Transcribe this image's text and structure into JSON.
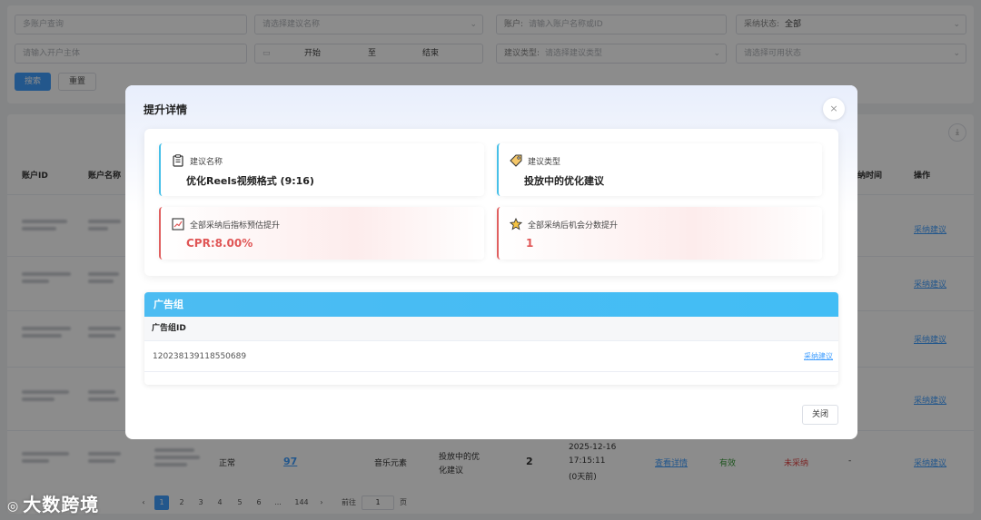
{
  "filters": {
    "row1": [
      {
        "placeholder": "多账户查询"
      },
      {
        "placeholder": "请选择建议名称"
      },
      {
        "label": "账户:",
        "placeholder": "请输入账户名称或ID"
      },
      {
        "label": "采纳状态:",
        "value": "全部"
      }
    ],
    "row2": [
      {
        "placeholder": "请输入开户主体"
      },
      {
        "start": "开始",
        "sep": "至",
        "end": "结束"
      },
      {
        "label": "建议类型:",
        "placeholder": "请选择建议类型"
      },
      {
        "placeholder": "请选择可用状态"
      }
    ],
    "search_label": "搜索",
    "reset_label": "重置"
  },
  "table": {
    "headers": {
      "account_id": "账户ID",
      "account_name": "账户名称",
      "adopt_time": "纳时间",
      "action": "操作"
    },
    "row_action": "采纳建议",
    "last_row": {
      "status": "正常",
      "count": "97",
      "element": "音乐元素",
      "type_line1": "投放中的优",
      "type_line2": "化建议",
      "score": "2",
      "date": "2025-12-16",
      "time": "17:15:11",
      "ago": "(0天前)",
      "view": "查看详情",
      "valid": "有效",
      "adopt_status": "未采纳",
      "dash": "-",
      "action": "采纳建议"
    }
  },
  "pagination": {
    "pages": [
      "1",
      "2",
      "3",
      "4",
      "5",
      "6",
      "...",
      "144"
    ],
    "prev": "‹",
    "next": "›",
    "goto_label": "前往",
    "goto_value": "1",
    "page_suffix": "页"
  },
  "watermark": "大数跨境",
  "modal": {
    "title": "提升详情",
    "close_icon": "×",
    "cards": {
      "name_label": "建议名称",
      "name_value": "优化Reels视频格式 (9:16)",
      "type_label": "建议类型",
      "type_value": "投放中的优化建议",
      "metric_label": "全部采纳后指标预估提升",
      "metric_value": "CPR:8.00%",
      "score_label": "全部采纳后机会分数提升",
      "score_value": "1"
    },
    "subtable": {
      "title": "广告组",
      "column": "广告组ID",
      "rows": [
        {
          "id": "120238139118550689",
          "action": "采纳建议"
        }
      ]
    },
    "close_label": "关闭"
  },
  "colors": {
    "accent": "#409eff",
    "sub_header": "#4cbcf2",
    "card_blue": "#47c0e8",
    "card_red": "#e06060",
    "metric_red": "#e05656"
  }
}
